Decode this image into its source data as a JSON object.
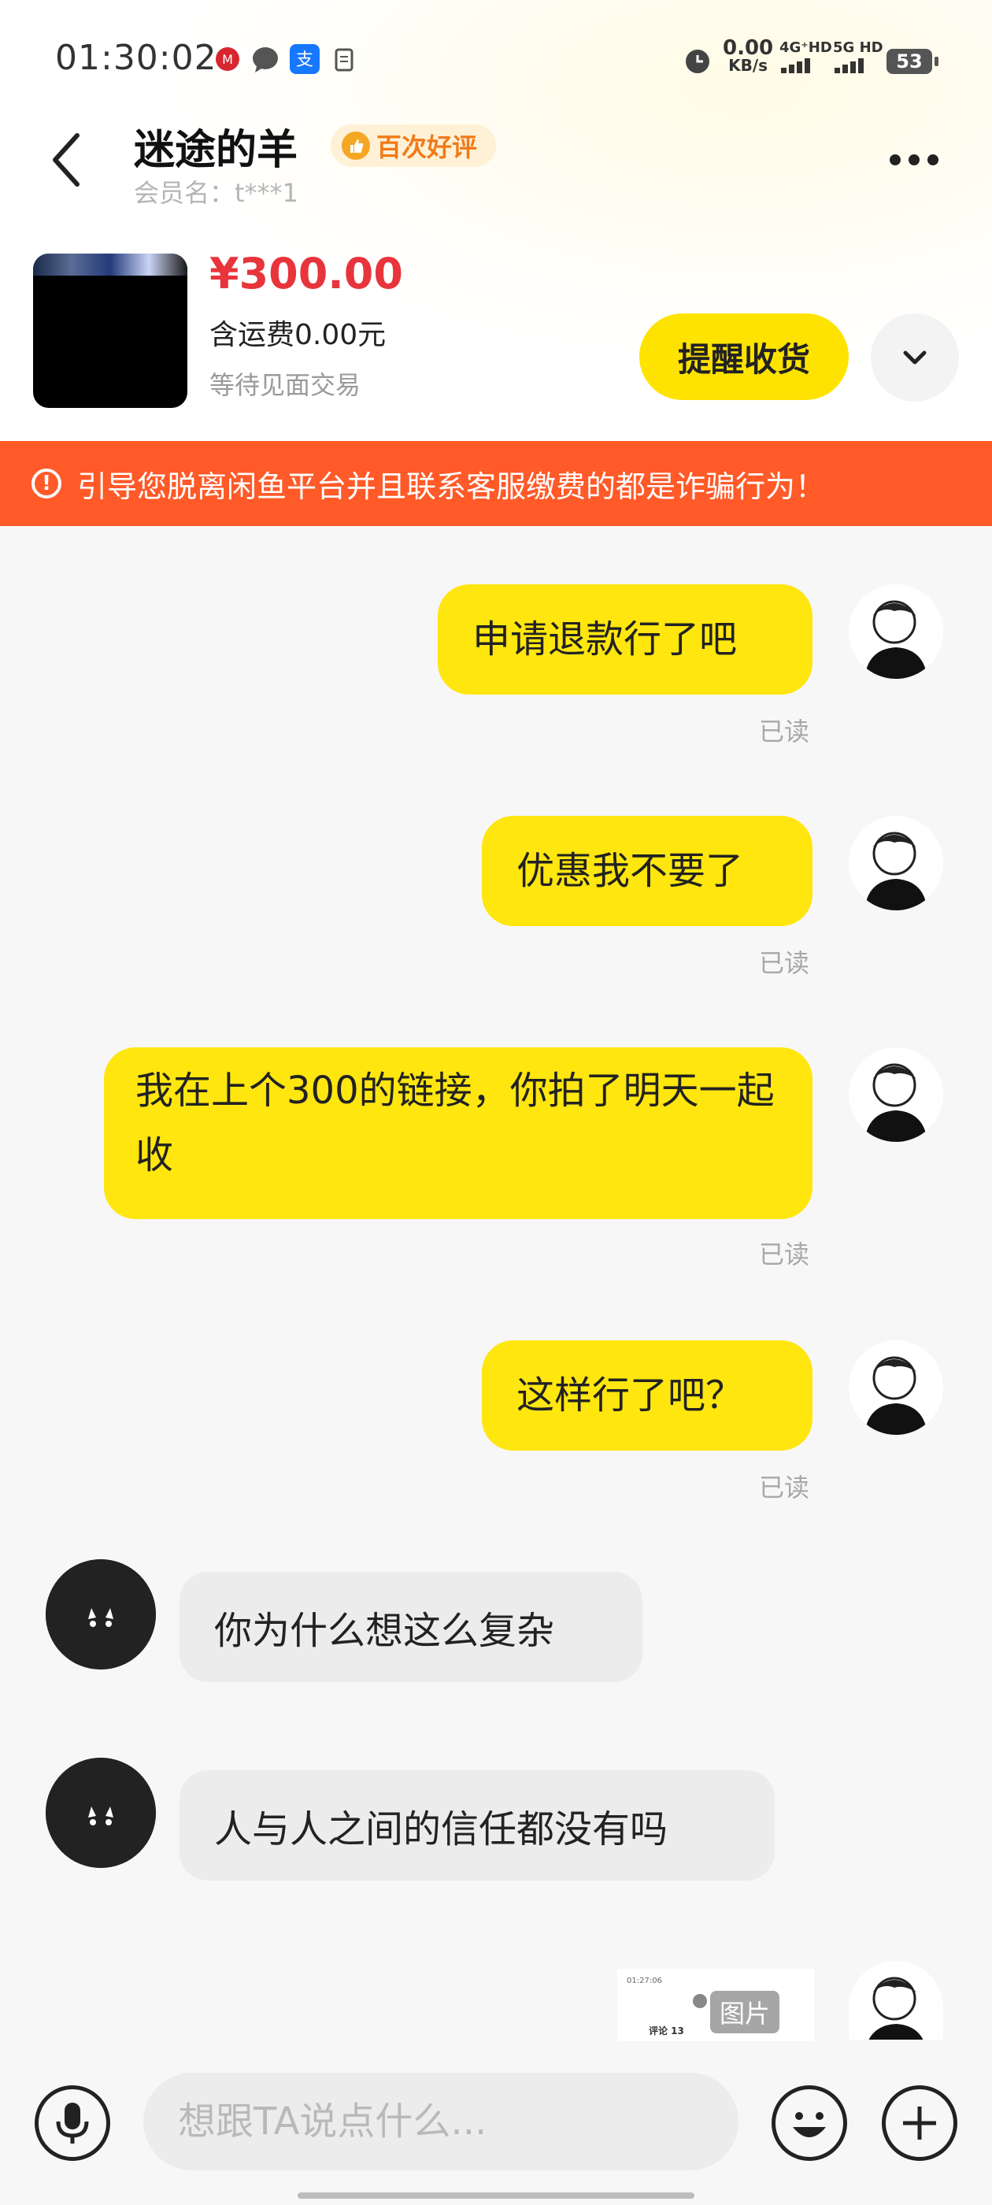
{
  "status_bar": {
    "time": "01:30:02",
    "net_speed": "0.00",
    "net_unit": "KB/s",
    "sim1": "4G⁺HD",
    "sim2": "5G HD",
    "battery": "53"
  },
  "header": {
    "title": "迷途的羊",
    "badge": "百次好评",
    "member": "会员名：t***1"
  },
  "product": {
    "price": "¥300.00",
    "shipping": "含运费0.00元",
    "status": "等待见面交易",
    "remind_button": "提醒收货"
  },
  "warning": "引导您脱离闲鱼平台并且联系客服缴费的都是诈骗行为！",
  "messages": [
    {
      "from": "me",
      "text": "申请退款行了吧",
      "status": "已读"
    },
    {
      "from": "me",
      "text": "优惠我不要了",
      "status": "已读"
    },
    {
      "from": "me",
      "text": "我在上个300的链接，你拍了明天一起收",
      "status": "已读"
    },
    {
      "from": "me",
      "text": "这样行了吧？",
      "status": "已读"
    },
    {
      "from": "them",
      "text": "你为什么想这么复杂"
    },
    {
      "from": "them",
      "text": "人与人之间的信任都没有吗"
    },
    {
      "from": "me",
      "type": "image",
      "label": "图片",
      "thumb_time": "01:27:06",
      "thumb_caption": "评论 13"
    }
  ],
  "input": {
    "placeholder": "想跟TA说点什么..."
  },
  "colors": {
    "accent_yellow": "#ffe60f",
    "warning_bg": "#ff5a28",
    "price_red": "#e8343b"
  }
}
